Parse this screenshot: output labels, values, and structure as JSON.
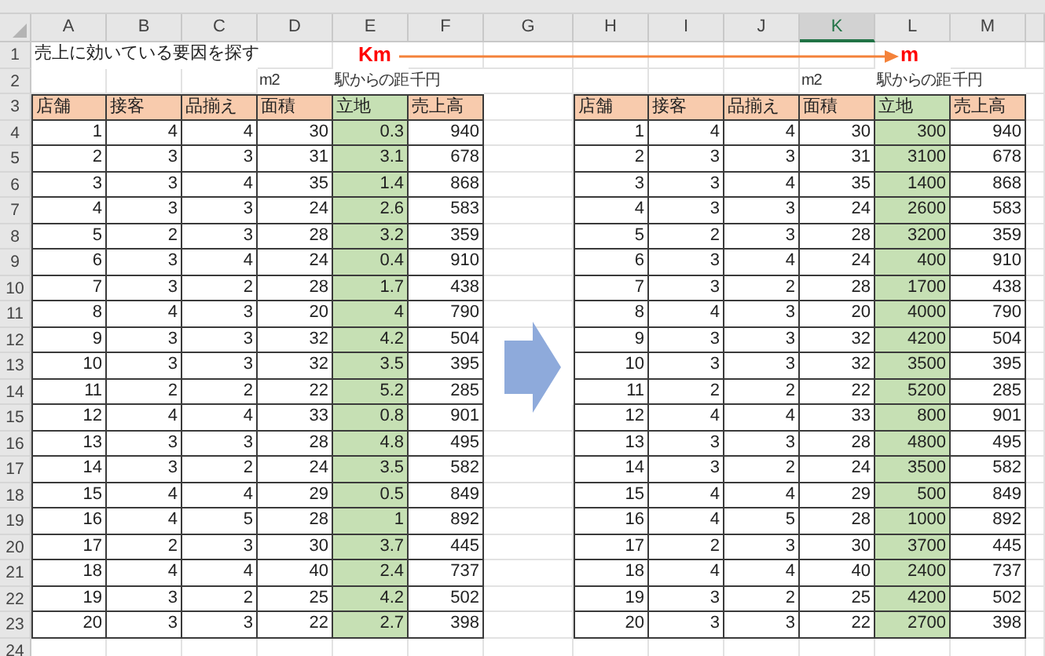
{
  "column_headers": [
    {
      "label": "A",
      "selected": false
    },
    {
      "label": "B",
      "selected": false
    },
    {
      "label": "C",
      "selected": false
    },
    {
      "label": "D",
      "selected": false
    },
    {
      "label": "E",
      "selected": false
    },
    {
      "label": "F",
      "selected": false
    },
    {
      "label": "G",
      "selected": false
    },
    {
      "label": "H",
      "selected": false
    },
    {
      "label": "I",
      "selected": false
    },
    {
      "label": "J",
      "selected": false
    },
    {
      "label": "K",
      "selected": true
    },
    {
      "label": "L",
      "selected": false
    },
    {
      "label": "M",
      "selected": false
    }
  ],
  "row_headers": [
    "1",
    "2",
    "3",
    "4",
    "5",
    "6",
    "7",
    "8",
    "9",
    "10",
    "11",
    "12",
    "13",
    "14",
    "15",
    "16",
    "17",
    "18",
    "19",
    "20",
    "21",
    "22",
    "23",
    "24"
  ],
  "title": "売上に効いている要因を探す",
  "from_unit": "Km",
  "to_unit": "m",
  "tables": [
    {
      "columns": [
        {
          "label": "店舗",
          "highlight": false
        },
        {
          "label": "接客",
          "highlight": false
        },
        {
          "label": "品揃え",
          "highlight": false
        },
        {
          "label": "面積",
          "highlight": false,
          "unit": "m2"
        },
        {
          "label": "立地",
          "highlight": true,
          "unit": "駅からの距"
        },
        {
          "label": "売上高",
          "highlight": false,
          "unit": "千円"
        }
      ],
      "rows": [
        [
          "1",
          "4",
          "4",
          "30",
          "0.3",
          "940"
        ],
        [
          "2",
          "3",
          "3",
          "31",
          "3.1",
          "678"
        ],
        [
          "3",
          "3",
          "4",
          "35",
          "1.4",
          "868"
        ],
        [
          "4",
          "3",
          "3",
          "24",
          "2.6",
          "583"
        ],
        [
          "5",
          "2",
          "3",
          "28",
          "3.2",
          "359"
        ],
        [
          "6",
          "3",
          "4",
          "24",
          "0.4",
          "910"
        ],
        [
          "7",
          "3",
          "2",
          "28",
          "1.7",
          "438"
        ],
        [
          "8",
          "4",
          "3",
          "20",
          "4",
          "790"
        ],
        [
          "9",
          "3",
          "3",
          "32",
          "4.2",
          "504"
        ],
        [
          "10",
          "3",
          "3",
          "32",
          "3.5",
          "395"
        ],
        [
          "11",
          "2",
          "2",
          "22",
          "5.2",
          "285"
        ],
        [
          "12",
          "4",
          "4",
          "33",
          "0.8",
          "901"
        ],
        [
          "13",
          "3",
          "3",
          "28",
          "4.8",
          "495"
        ],
        [
          "14",
          "3",
          "2",
          "24",
          "3.5",
          "582"
        ],
        [
          "15",
          "4",
          "4",
          "29",
          "0.5",
          "849"
        ],
        [
          "16",
          "4",
          "5",
          "28",
          "1",
          "892"
        ],
        [
          "17",
          "2",
          "3",
          "30",
          "3.7",
          "445"
        ],
        [
          "18",
          "4",
          "4",
          "40",
          "2.4",
          "737"
        ],
        [
          "19",
          "3",
          "2",
          "25",
          "4.2",
          "502"
        ],
        [
          "20",
          "3",
          "3",
          "22",
          "2.7",
          "398"
        ]
      ]
    },
    {
      "columns": [
        {
          "label": "店舗",
          "highlight": false
        },
        {
          "label": "接客",
          "highlight": false
        },
        {
          "label": "品揃え",
          "highlight": false
        },
        {
          "label": "面積",
          "highlight": false,
          "unit": "m2"
        },
        {
          "label": "立地",
          "highlight": true,
          "unit": "駅からの距"
        },
        {
          "label": "売上高",
          "highlight": false,
          "unit": "千円"
        }
      ],
      "rows": [
        [
          "1",
          "4",
          "4",
          "30",
          "300",
          "940"
        ],
        [
          "2",
          "3",
          "3",
          "31",
          "3100",
          "678"
        ],
        [
          "3",
          "3",
          "4",
          "35",
          "1400",
          "868"
        ],
        [
          "4",
          "3",
          "3",
          "24",
          "2600",
          "583"
        ],
        [
          "5",
          "2",
          "3",
          "28",
          "3200",
          "359"
        ],
        [
          "6",
          "3",
          "4",
          "24",
          "400",
          "910"
        ],
        [
          "7",
          "3",
          "2",
          "28",
          "1700",
          "438"
        ],
        [
          "8",
          "4",
          "3",
          "20",
          "4000",
          "790"
        ],
        [
          "9",
          "3",
          "3",
          "32",
          "4200",
          "504"
        ],
        [
          "10",
          "3",
          "3",
          "32",
          "3500",
          "395"
        ],
        [
          "11",
          "2",
          "2",
          "22",
          "5200",
          "285"
        ],
        [
          "12",
          "4",
          "4",
          "33",
          "800",
          "901"
        ],
        [
          "13",
          "3",
          "3",
          "28",
          "4800",
          "495"
        ],
        [
          "14",
          "3",
          "2",
          "24",
          "3500",
          "582"
        ],
        [
          "15",
          "4",
          "4",
          "29",
          "500",
          "849"
        ],
        [
          "16",
          "4",
          "5",
          "28",
          "1000",
          "892"
        ],
        [
          "17",
          "2",
          "3",
          "30",
          "3700",
          "445"
        ],
        [
          "18",
          "4",
          "4",
          "40",
          "2400",
          "737"
        ],
        [
          "19",
          "3",
          "2",
          "25",
          "4200",
          "502"
        ],
        [
          "20",
          "3",
          "3",
          "22",
          "2700",
          "398"
        ]
      ]
    }
  ]
}
